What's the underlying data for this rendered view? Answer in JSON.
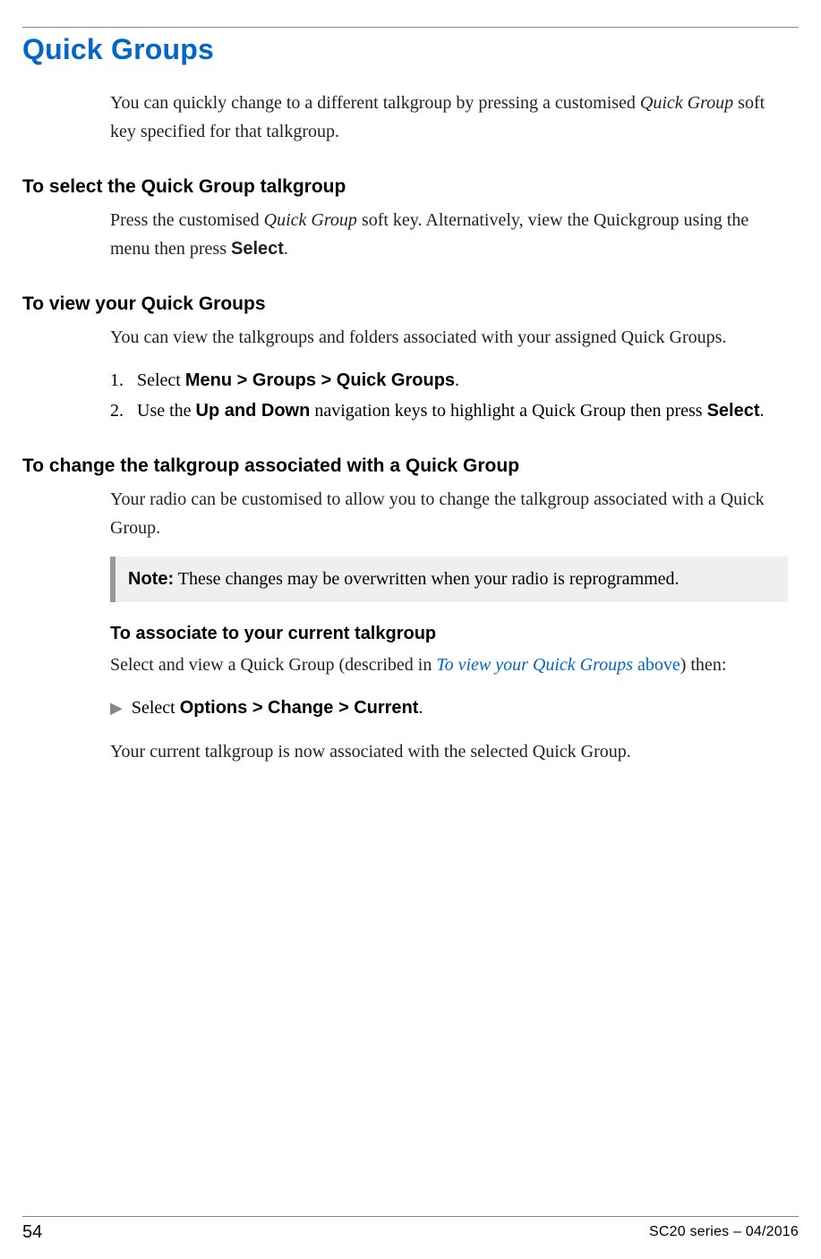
{
  "title": "Quick Groups",
  "intro": {
    "pre": "You can quickly change to a different talkgroup by pressing a customised ",
    "italic": "Quick Group",
    "post": " soft key specified for that talkgroup."
  },
  "sec1": {
    "heading": "To select the Quick Group talkgroup",
    "body": {
      "p1a": "Press the customised ",
      "p1_italic": "Quick Group",
      "p1b": " soft key. Alternatively, view the Quickgroup using the menu then press ",
      "p1_bold": "Select",
      "p1c": "."
    }
  },
  "sec2": {
    "heading": "To view your Quick Groups",
    "intro": "You can view the talkgroups and folders associated with your assigned Quick Groups.",
    "steps": {
      "s1": {
        "num": "1.",
        "a": "Select ",
        "b": "Menu > Groups > Quick Groups",
        "c": "."
      },
      "s2": {
        "num": "2.",
        "a": "Use the ",
        "b": "Up and Down",
        "c": " navigation keys to highlight a Quick Group then press ",
        "d": "Select",
        "e": "."
      }
    }
  },
  "sec3": {
    "heading": "To change the talkgroup associated with a Quick Group",
    "intro": "Your radio can be customised to allow you to change the talkgroup associated with a Quick Group.",
    "note": {
      "label": "Note:",
      "text": "  These changes may be overwritten when your radio is reprogrammed."
    },
    "sub": {
      "heading": "To associate to your current talkgroup",
      "p1a": "Select and view a Quick Group (described in ",
      "link1": "To view your Quick Groups",
      "link2": " above",
      "p1b": ") then:",
      "step_a": "Select ",
      "step_b": "Options > Change > Current",
      "step_c": ".",
      "result": "Your current talkgroup is now associated with the selected Quick Group."
    }
  },
  "footer": {
    "page": "54",
    "docid": "SC20 series – 04/2016"
  }
}
